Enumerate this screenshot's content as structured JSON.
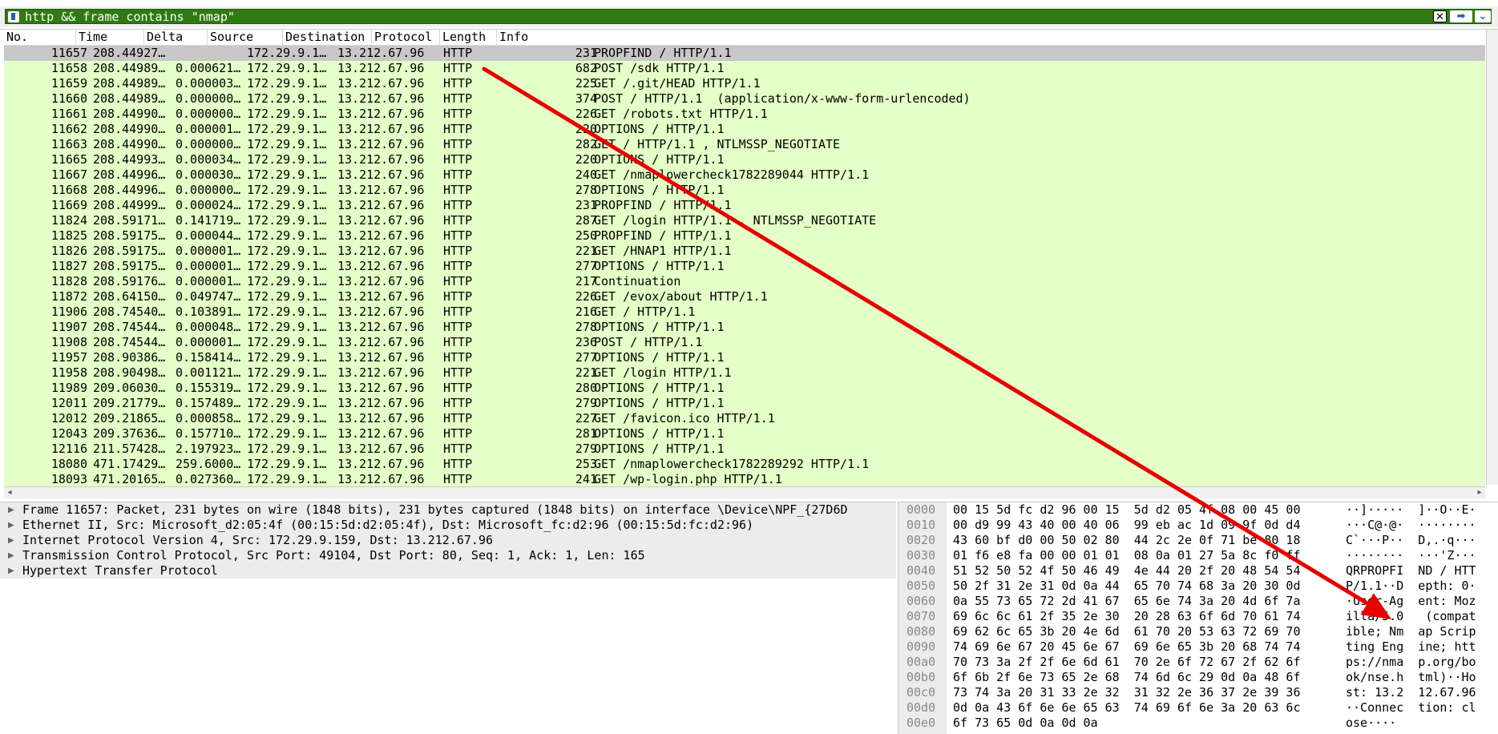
{
  "filter": {
    "text": "http && frame contains \"nmap\"",
    "clear_label": "✕",
    "apply_label": "➡",
    "dropdown_label": "⌄"
  },
  "columns": {
    "no": "No.",
    "time": "Time",
    "delta": "Delta",
    "source": "Source",
    "destination": "Destination",
    "protocol": "Protocol",
    "length": "Length",
    "info": "Info"
  },
  "packets": [
    {
      "no": "11657",
      "time": "208.44927…",
      "delta": "",
      "src": "172.29.9.1…",
      "dst": "13.212.67.96",
      "proto": "HTTP",
      "len": "231",
      "info": "PROPFIND / HTTP/1.1"
    },
    {
      "no": "11658",
      "time": "208.44989…",
      "delta": "0.000621…",
      "src": "172.29.9.1…",
      "dst": "13.212.67.96",
      "proto": "HTTP",
      "len": "682",
      "info": "POST /sdk HTTP/1.1"
    },
    {
      "no": "11659",
      "time": "208.44989…",
      "delta": "0.000003…",
      "src": "172.29.9.1…",
      "dst": "13.212.67.96",
      "proto": "HTTP",
      "len": "225",
      "info": "GET /.git/HEAD HTTP/1.1"
    },
    {
      "no": "11660",
      "time": "208.44989…",
      "delta": "0.000000…",
      "src": "172.29.9.1…",
      "dst": "13.212.67.96",
      "proto": "HTTP",
      "len": "374",
      "info": "POST / HTTP/1.1  (application/x-www-form-urlencoded)"
    },
    {
      "no": "11661",
      "time": "208.44990…",
      "delta": "0.000000…",
      "src": "172.29.9.1…",
      "dst": "13.212.67.96",
      "proto": "HTTP",
      "len": "226",
      "info": "GET /robots.txt HTTP/1.1"
    },
    {
      "no": "11662",
      "time": "208.44990…",
      "delta": "0.000001…",
      "src": "172.29.9.1…",
      "dst": "13.212.67.96",
      "proto": "HTTP",
      "len": "220",
      "info": "OPTIONS / HTTP/1.1"
    },
    {
      "no": "11663",
      "time": "208.44990…",
      "delta": "0.000000…",
      "src": "172.29.9.1…",
      "dst": "13.212.67.96",
      "proto": "HTTP",
      "len": "282",
      "info": "GET / HTTP/1.1 , NTLMSSP_NEGOTIATE"
    },
    {
      "no": "11665",
      "time": "208.44993…",
      "delta": "0.000034…",
      "src": "172.29.9.1…",
      "dst": "13.212.67.96",
      "proto": "HTTP",
      "len": "220",
      "info": "OPTIONS / HTTP/1.1"
    },
    {
      "no": "11667",
      "time": "208.44996…",
      "delta": "0.000030…",
      "src": "172.29.9.1…",
      "dst": "13.212.67.96",
      "proto": "HTTP",
      "len": "240",
      "info": "GET /nmaplowercheck1782289044 HTTP/1.1"
    },
    {
      "no": "11668",
      "time": "208.44996…",
      "delta": "0.000000…",
      "src": "172.29.9.1…",
      "dst": "13.212.67.96",
      "proto": "HTTP",
      "len": "278",
      "info": "OPTIONS / HTTP/1.1"
    },
    {
      "no": "11669",
      "time": "208.44999…",
      "delta": "0.000024…",
      "src": "172.29.9.1…",
      "dst": "13.212.67.96",
      "proto": "HTTP",
      "len": "231",
      "info": "PROPFIND / HTTP/1.1"
    },
    {
      "no": "11824",
      "time": "208.59171…",
      "delta": "0.141719…",
      "src": "172.29.9.1…",
      "dst": "13.212.67.96",
      "proto": "HTTP",
      "len": "287",
      "info": "GET /login HTTP/1.1 , NTLMSSP_NEGOTIATE"
    },
    {
      "no": "11825",
      "time": "208.59175…",
      "delta": "0.000044…",
      "src": "172.29.9.1…",
      "dst": "13.212.67.96",
      "proto": "HTTP",
      "len": "250",
      "info": "PROPFIND / HTTP/1.1"
    },
    {
      "no": "11826",
      "time": "208.59175…",
      "delta": "0.000001…",
      "src": "172.29.9.1…",
      "dst": "13.212.67.96",
      "proto": "HTTP",
      "len": "221",
      "info": "GET /HNAP1 HTTP/1.1"
    },
    {
      "no": "11827",
      "time": "208.59175…",
      "delta": "0.000001…",
      "src": "172.29.9.1…",
      "dst": "13.212.67.96",
      "proto": "HTTP",
      "len": "277",
      "info": "OPTIONS / HTTP/1.1"
    },
    {
      "no": "11828",
      "time": "208.59176…",
      "delta": "0.000001…",
      "src": "172.29.9.1…",
      "dst": "13.212.67.96",
      "proto": "HTTP",
      "len": "217",
      "info": "Continuation"
    },
    {
      "no": "11872",
      "time": "208.64150…",
      "delta": "0.049747…",
      "src": "172.29.9.1…",
      "dst": "13.212.67.96",
      "proto": "HTTP",
      "len": "226",
      "info": "GET /evox/about HTTP/1.1"
    },
    {
      "no": "11906",
      "time": "208.74540…",
      "delta": "0.103891…",
      "src": "172.29.9.1…",
      "dst": "13.212.67.96",
      "proto": "HTTP",
      "len": "216",
      "info": "GET / HTTP/1.1"
    },
    {
      "no": "11907",
      "time": "208.74544…",
      "delta": "0.000048…",
      "src": "172.29.9.1…",
      "dst": "13.212.67.96",
      "proto": "HTTP",
      "len": "278",
      "info": "OPTIONS / HTTP/1.1"
    },
    {
      "no": "11908",
      "time": "208.74544…",
      "delta": "0.000001…",
      "src": "172.29.9.1…",
      "dst": "13.212.67.96",
      "proto": "HTTP",
      "len": "236",
      "info": "POST / HTTP/1.1"
    },
    {
      "no": "11957",
      "time": "208.90386…",
      "delta": "0.158414…",
      "src": "172.29.9.1…",
      "dst": "13.212.67.96",
      "proto": "HTTP",
      "len": "277",
      "info": "OPTIONS / HTTP/1.1"
    },
    {
      "no": "11958",
      "time": "208.90498…",
      "delta": "0.001121…",
      "src": "172.29.9.1…",
      "dst": "13.212.67.96",
      "proto": "HTTP",
      "len": "221",
      "info": "GET /login HTTP/1.1"
    },
    {
      "no": "11989",
      "time": "209.06030…",
      "delta": "0.155319…",
      "src": "172.29.9.1…",
      "dst": "13.212.67.96",
      "proto": "HTTP",
      "len": "280",
      "info": "OPTIONS / HTTP/1.1"
    },
    {
      "no": "12011",
      "time": "209.21779…",
      "delta": "0.157489…",
      "src": "172.29.9.1…",
      "dst": "13.212.67.96",
      "proto": "HTTP",
      "len": "279",
      "info": "OPTIONS / HTTP/1.1"
    },
    {
      "no": "12012",
      "time": "209.21865…",
      "delta": "0.000858…",
      "src": "172.29.9.1…",
      "dst": "13.212.67.96",
      "proto": "HTTP",
      "len": "227",
      "info": "GET /favicon.ico HTTP/1.1"
    },
    {
      "no": "12043",
      "time": "209.37636…",
      "delta": "0.157710…",
      "src": "172.29.9.1…",
      "dst": "13.212.67.96",
      "proto": "HTTP",
      "len": "281",
      "info": "OPTIONS / HTTP/1.1"
    },
    {
      "no": "12116",
      "time": "211.57428…",
      "delta": "2.197923…",
      "src": "172.29.9.1…",
      "dst": "13.212.67.96",
      "proto": "HTTP",
      "len": "279",
      "info": "OPTIONS / HTTP/1.1"
    },
    {
      "no": "18080",
      "time": "471.17429…",
      "delta": "259.6000…",
      "src": "172.29.9.1…",
      "dst": "13.212.67.96",
      "proto": "HTTP",
      "len": "253",
      "info": "GET /nmaplowercheck1782289292 HTTP/1.1"
    },
    {
      "no": "18093",
      "time": "471.20165…",
      "delta": "0.027360…",
      "src": "172.29.9.1…",
      "dst": "13.212.67.96",
      "proto": "HTTP",
      "len": "241",
      "info": "GET /wp-login.php HTTP/1.1"
    }
  ],
  "details": [
    "Frame 11657: Packet, 231 bytes on wire (1848 bits), 231 bytes captured (1848 bits) on interface \\Device\\NPF_{27D6D",
    "Ethernet II, Src: Microsoft_d2:05:4f (00:15:5d:d2:05:4f), Dst: Microsoft_fc:d2:96 (00:15:5d:fc:d2:96)",
    "Internet Protocol Version 4, Src: 172.29.9.159, Dst: 13.212.67.96",
    "Transmission Control Protocol, Src Port: 49104, Dst Port: 80, Seq: 1, Ack: 1, Len: 165",
    "Hypertext Transfer Protocol"
  ],
  "hexdump": [
    {
      "off": "0000",
      "hex": "00 15 5d fc d2 96 00 15  5d d2 05 4f 08 00 45 00",
      "ascii": "··]·····  ]··O··E·"
    },
    {
      "off": "0010",
      "hex": "00 d9 99 43 40 00 40 06  99 eb ac 1d 09 9f 0d d4",
      "ascii": "···C@·@·  ········"
    },
    {
      "off": "0020",
      "hex": "43 60 bf d0 00 50 02 80  44 2c 2e 0f 71 be 80 18",
      "ascii": "C`···P··  D,.·q···"
    },
    {
      "off": "0030",
      "hex": "01 f6 e8 fa 00 00 01 01  08 0a 01 27 5a 8c f0 ff",
      "ascii": "········  ···'Z···"
    },
    {
      "off": "0040",
      "hex": "51 52 50 52 4f 50 46 49  4e 44 20 2f 20 48 54 54",
      "ascii": "QRPROPFI  ND / HTT"
    },
    {
      "off": "0050",
      "hex": "50 2f 31 2e 31 0d 0a 44  65 70 74 68 3a 20 30 0d",
      "ascii": "P/1.1··D  epth: 0·"
    },
    {
      "off": "0060",
      "hex": "0a 55 73 65 72 2d 41 67  65 6e 74 3a 20 4d 6f 7a",
      "ascii": "·User-Ag  ent: Moz"
    },
    {
      "off": "0070",
      "hex": "69 6c 6c 61 2f 35 2e 30  20 28 63 6f 6d 70 61 74",
      "ascii": "illa/5.0   (compat"
    },
    {
      "off": "0080",
      "hex": "69 62 6c 65 3b 20 4e 6d  61 70 20 53 63 72 69 70",
      "ascii": "ible; Nm  ap Scrip"
    },
    {
      "off": "0090",
      "hex": "74 69 6e 67 20 45 6e 67  69 6e 65 3b 20 68 74 74",
      "ascii": "ting Eng  ine; htt"
    },
    {
      "off": "00a0",
      "hex": "70 73 3a 2f 2f 6e 6d 61  70 2e 6f 72 67 2f 62 6f",
      "ascii": "ps://nma  p.org/bo"
    },
    {
      "off": "00b0",
      "hex": "6f 6b 2f 6e 73 65 2e 68  74 6d 6c 29 0d 0a 48 6f",
      "ascii": "ok/nse.h  tml)··Ho"
    },
    {
      "off": "00c0",
      "hex": "73 74 3a 20 31 33 2e 32  31 32 2e 36 37 2e 39 36",
      "ascii": "st: 13.2  12.67.96"
    },
    {
      "off": "00d0",
      "hex": "0d 0a 43 6f 6e 6e 65 63  74 69 6f 6e 3a 20 63 6c",
      "ascii": "··Connec  tion: cl"
    },
    {
      "off": "00e0",
      "hex": "6f 73 65 0d 0a 0d 0a",
      "ascii": "ose····"
    }
  ],
  "colors": {
    "filter_bg": "#2f7a12",
    "row_bg": "#e4ffc7",
    "selected_bg": "#c8c8c8",
    "arrow": "#e60000"
  }
}
